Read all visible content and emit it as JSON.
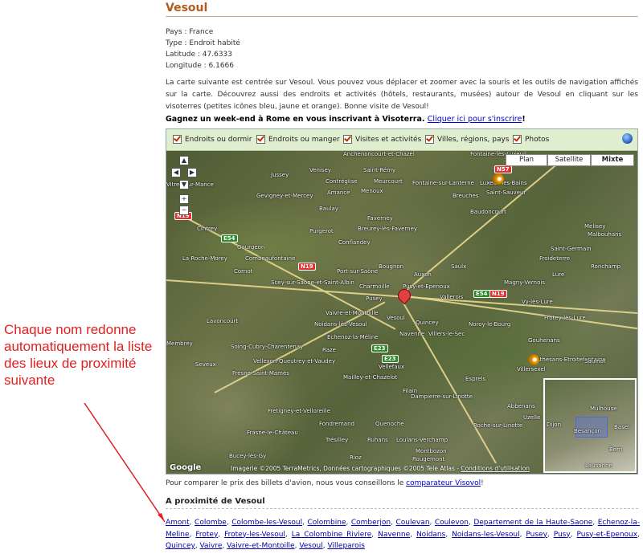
{
  "page": {
    "title": "Vesoul",
    "meta": {
      "country": "Pays : France",
      "type": "Type : Endroit habité",
      "latitude": "Latitude : 47.6333",
      "longitude": "Longitude : 6.1666"
    },
    "description": "La carte suivante est centrée sur Vesoul. Vous pouvez vous déplacer et zoomer avec la souris et les outils de navigation affichés sur la carte. Découvrez aussi des endroits et activités (hôtels, restaurants, musées) autour de Vesoul en cliquant sur les visoterres (petites icônes bleu, jaune et orange). Bonne visite de Vesoul!",
    "promo_text": "Gagnez un week-end à Rome en vous inscrivant à Visoterra. ",
    "promo_link": "Cliquer ici pour s'inscrire",
    "promo_end": "!"
  },
  "filters": [
    {
      "label": "Endroits ou dormir",
      "checked": true
    },
    {
      "label": "Endroits ou manger",
      "checked": true
    },
    {
      "label": "Visites et activités",
      "checked": true
    },
    {
      "label": "Villes, régions, pays",
      "checked": true
    },
    {
      "label": "Photos",
      "checked": true
    }
  ],
  "map": {
    "types": [
      "Plan",
      "Satellite",
      "Mixte"
    ],
    "active_type": "Mixte",
    "copyright_text": "Imagerie ©2005 TerraMetrics, Données cartographiques ©2005 Tele Atlas - ",
    "copyright_link": "Conditions d'utilisation",
    "google": "Google",
    "places": [
      "Anchenoncourt-et-Chazel",
      "Fontaine-lès-Luxeuil",
      "Venisey",
      "Saint-Rémy",
      "Jussey",
      "Contréglise",
      "Meurcourt",
      "Vitrey-sur-Mance",
      "Gevigney-et-Mercey",
      "Amance",
      "Menoux",
      "Fontaine-sur-Lanterne",
      "Luxeuil-les-Bains",
      "Saint-Sauveur",
      "Breuches",
      "Baulay",
      "Baudoncourt",
      "Faverney",
      "Breurey-lès-Faverney",
      "Cintrey",
      "Purgerot",
      "Conflandey",
      "Gourgeon",
      "Combeaufontaine",
      "La Roche-Morey",
      "Port-sur-Saône",
      "Bougnon",
      "Auxon",
      "Saulx",
      "Cornot",
      "Scey-sur-Saône-et-Saint-Albin",
      "Charmoille",
      "Pusy-et-Epenoux",
      "Pusey",
      "Vaivre-et-Montoille",
      "Vesoul",
      "Quincey",
      "Noidans-lès-Vesoul",
      "Navenne",
      "Villers-le-Sec",
      "Echenoz-la-Méline",
      "Vallerois",
      "Noroy-le-Bourg",
      "Saint-Germain",
      "Froideterre",
      "Lure",
      "Magny-Vernois",
      "Vy-lès-Lure",
      "Frotey-lès-Lure",
      "Athesans-Etroitefontaine",
      "Lavoncourt",
      "Membrey",
      "Soing-Cubry-Charentenay",
      "Raze",
      "Vellexon-Queutrey-et-Vaudey",
      "Fresne-Saint-Mamès",
      "Seveux",
      "Mailley-et-Chazelot",
      "Vellefaux",
      "Filain",
      "Dampierre-sur-Linotte",
      "Esprels",
      "Villersexel",
      "Fretigney-et-Velloreille",
      "Fondremand",
      "Quenoche",
      "Frasne-le-Château",
      "Trésilley",
      "Ruhans",
      "Loulans-Verchamp",
      "Bucey-lès-Gy",
      "Rioz",
      "Montbozon",
      "Rougemont",
      "Melisey",
      "Malbouhans",
      "Ronchamp",
      "Saulnot",
      "Gouhenans",
      "Abbenans",
      "Uzelle",
      "Roche-sur-Linotte"
    ],
    "overview_places": [
      "Mulhouse",
      "Dijon",
      "Besançon",
      "Basel",
      "Bern",
      "Lausanne"
    ]
  },
  "compare": {
    "text": "Pour comparer le prix des billets d'avion, nous vous conseillons le ",
    "link": "comparateur Visovol",
    "end": "!"
  },
  "nearby": {
    "title": "A proximité de Vesoul",
    "links": [
      "Amont",
      "Colombe",
      "Colombe-les-Vesoul",
      "Colombine",
      "Comberjon",
      "Coulevan",
      "Coulevon",
      "Departement de la Haute-Saone",
      "Echenoz-la-Meline",
      "Frotey",
      "Frotey-les-Vesoul",
      "La Colombine Riviere",
      "Navenne",
      "Noidans",
      "Noidans-les-Vesoul",
      "Pusey",
      "Pusy",
      "Pusy-et-Epenoux",
      "Quincey",
      "Vaivre",
      "Vaivre-et-Montoille",
      "Vesoul",
      "Villeparois"
    ]
  },
  "annotation": {
    "text": "Chaque nom redonne automatiquement  la liste des lieux de proximité suivante",
    "color": "#e02020"
  }
}
